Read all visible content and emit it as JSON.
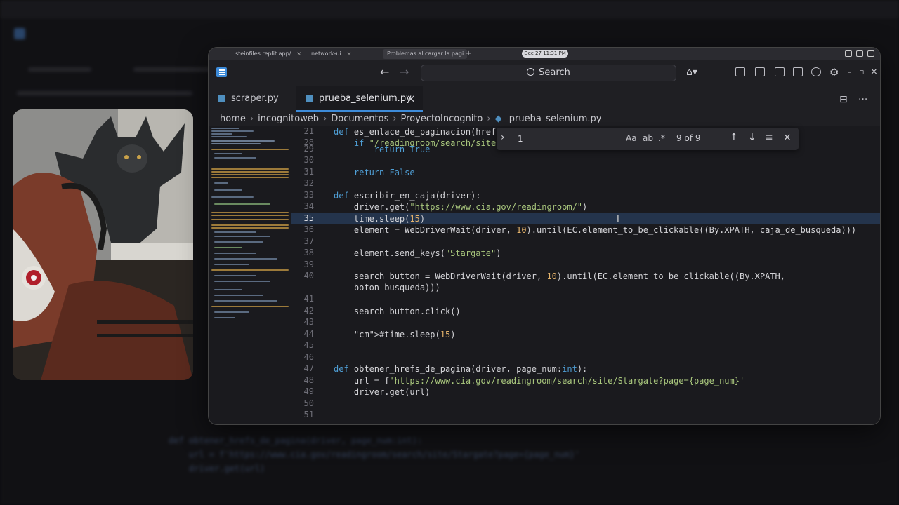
{
  "browser": {
    "tabs": [
      {
        "label": "steinfiles.replit.app/",
        "close": "×"
      },
      {
        "label": "network-ui",
        "close": "×"
      },
      {
        "label": "Problemas al cargar la pagi",
        "close": "×"
      }
    ],
    "new_tab": "+",
    "clock": "Dec 27  11:31 PM"
  },
  "titlebar": {
    "search_label": "Search",
    "back_icon": "arrow-left-icon",
    "forward_icon": "arrow-right-icon",
    "minimize": "–",
    "maximize": "▫",
    "close": "×"
  },
  "tabs": [
    {
      "label": "scraper.py",
      "active": false
    },
    {
      "label": "prueba_selenium.py",
      "active": true,
      "close": "×"
    }
  ],
  "breadcrumb": [
    "home",
    "incognitoweb",
    "Documentos",
    "ProyectoIncognito",
    "prueba_selenium.py"
  ],
  "find": {
    "value": "1",
    "case_label": "Aa",
    "word_label": "ab",
    "regex_label": ".*",
    "count": "9 of 9"
  },
  "lines": [
    {
      "n": "21",
      "text": "def es_enlace_de_paginacion(href):"
    },
    {
      "n": "28",
      "text": "    if \"/readingroom/search/site/Stargate\" in href:"
    },
    {
      "n": "29",
      "text": "        return True"
    },
    {
      "n": "30",
      "text": ""
    },
    {
      "n": "31",
      "text": "    return False"
    },
    {
      "n": "32",
      "text": ""
    },
    {
      "n": "33",
      "text": "def escribir_en_caja(driver):"
    },
    {
      "n": "34",
      "text": "    driver.get(\"https://www.cia.gov/readingroom/\")"
    },
    {
      "n": "35",
      "text": "    time.sleep(15)"
    },
    {
      "n": "36",
      "text": "    element = WebDriverWait(driver, 10).until(EC.element_to_be_clickable((By.XPATH, caja_de_busqueda)))"
    },
    {
      "n": "37",
      "text": ""
    },
    {
      "n": "38",
      "text": "    element.send_keys(\"Stargate\")"
    },
    {
      "n": "39",
      "text": ""
    },
    {
      "n": "40",
      "text": "    search_button = WebDriverWait(driver, 10).until(EC.element_to_be_clickable((By.XPATH,"
    },
    {
      "n": "",
      "text": "    boton_busqueda)))"
    },
    {
      "n": "41",
      "text": ""
    },
    {
      "n": "42",
      "text": "    search_button.click()"
    },
    {
      "n": "43",
      "text": ""
    },
    {
      "n": "44",
      "text": "    #time.sleep(15)"
    },
    {
      "n": "45",
      "text": ""
    },
    {
      "n": "46",
      "text": ""
    },
    {
      "n": "47",
      "text": "def obtener_hrefs_de_pagina(driver, page_num:int):"
    },
    {
      "n": "48",
      "text": "    url = f'https://www.cia.gov/readingroom/search/site/Stargate?page={page_num}'"
    },
    {
      "n": "49",
      "text": "    driver.get(url)"
    },
    {
      "n": "50",
      "text": ""
    },
    {
      "n": "51",
      "text": ""
    }
  ],
  "background_code": [
    "def obtener_hrefs_de_pagina(driver, page_num:int):",
    "    url = f'https://www.cia.gov/readingroom/search/site/Stargate?page={page_num}'",
    "    driver.get(url)"
  ]
}
